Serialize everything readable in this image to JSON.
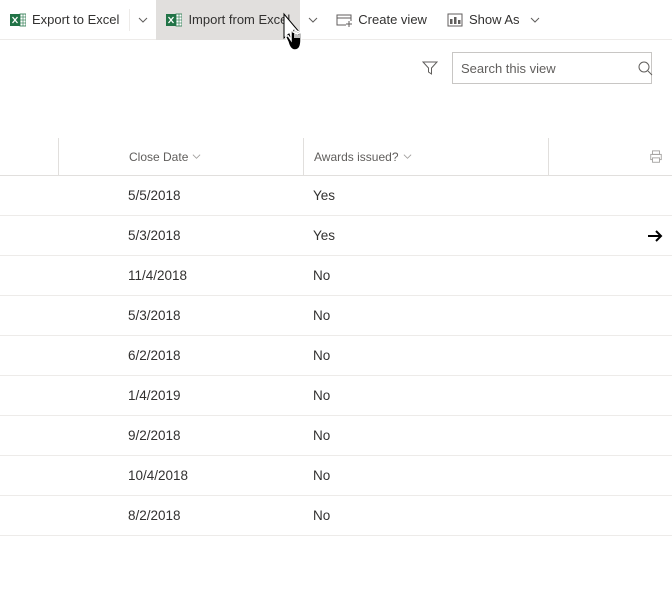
{
  "toolbar": {
    "export_label": "Export to Excel",
    "import_label": "Import from Excel",
    "create_view_label": "Create view",
    "show_as_label": "Show As"
  },
  "search": {
    "placeholder": "Search this view"
  },
  "columns": {
    "close_date": "Close Date",
    "awards": "Awards issued?"
  },
  "rows": [
    {
      "close": "5/5/2018",
      "awards": "Yes",
      "arrow": false
    },
    {
      "close": "5/3/2018",
      "awards": "Yes",
      "arrow": true
    },
    {
      "close": "11/4/2018",
      "awards": "No",
      "arrow": false
    },
    {
      "close": "5/3/2018",
      "awards": "No",
      "arrow": false
    },
    {
      "close": "6/2/2018",
      "awards": "No",
      "arrow": false
    },
    {
      "close": "1/4/2019",
      "awards": "No",
      "arrow": false
    },
    {
      "close": "9/2/2018",
      "awards": "No",
      "arrow": false
    },
    {
      "close": "10/4/2018",
      "awards": "No",
      "arrow": false
    },
    {
      "close": "8/2/2018",
      "awards": "No",
      "arrow": false
    }
  ]
}
